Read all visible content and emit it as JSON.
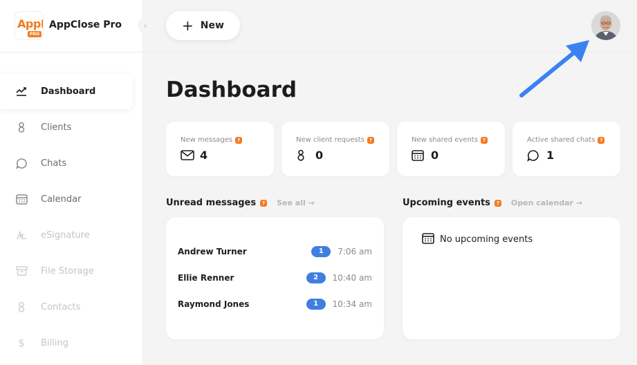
{
  "app": {
    "name": "AppClose Pro",
    "logo_main": "AppP",
    "logo_badge": "PRO"
  },
  "sidebar": {
    "items": [
      {
        "label": "Dashboard",
        "icon": "trend-icon",
        "state": "active"
      },
      {
        "label": "Clients",
        "icon": "person-icon",
        "state": "dim"
      },
      {
        "label": "Chats",
        "icon": "chat-bubble-icon",
        "state": "dim"
      },
      {
        "label": "Calendar",
        "icon": "calendar-icon",
        "state": "dim"
      },
      {
        "label": "eSignature",
        "icon": "signature-icon",
        "state": "faint"
      },
      {
        "label": "File Storage",
        "icon": "archive-box-icon",
        "state": "faint"
      },
      {
        "label": "Contacts",
        "icon": "person-icon",
        "state": "faint"
      },
      {
        "label": "Billing",
        "icon": "dollar-icon",
        "state": "faint"
      }
    ]
  },
  "topbar": {
    "new_label": "New"
  },
  "main": {
    "title": "Dashboard"
  },
  "stats": [
    {
      "label": "New messages",
      "value": "4",
      "icon": "envelope-icon"
    },
    {
      "label": "New client requests",
      "value": "0",
      "icon": "person-icon"
    },
    {
      "label": "New shared events",
      "value": "0",
      "icon": "calendar-icon"
    },
    {
      "label": "Active shared chats",
      "value": "1",
      "icon": "chat-bubble-icon"
    }
  ],
  "unread": {
    "title": "Unread messages",
    "link": "See all →",
    "rows": [
      {
        "name": "Andrew Turner",
        "count": "1",
        "time": "7:06 am"
      },
      {
        "name": "Ellie Renner",
        "count": "2",
        "time": "10:40 am"
      },
      {
        "name": "Raymond Jones",
        "count": "1",
        "time": "10:34 am"
      }
    ]
  },
  "events": {
    "title": "Upcoming events",
    "link": "Open calendar →",
    "empty": "No upcoming events"
  },
  "help_mark": "?",
  "colors": {
    "accent": "#f37b20",
    "badge": "#3f7fe0",
    "arrow": "#3b82f0"
  }
}
